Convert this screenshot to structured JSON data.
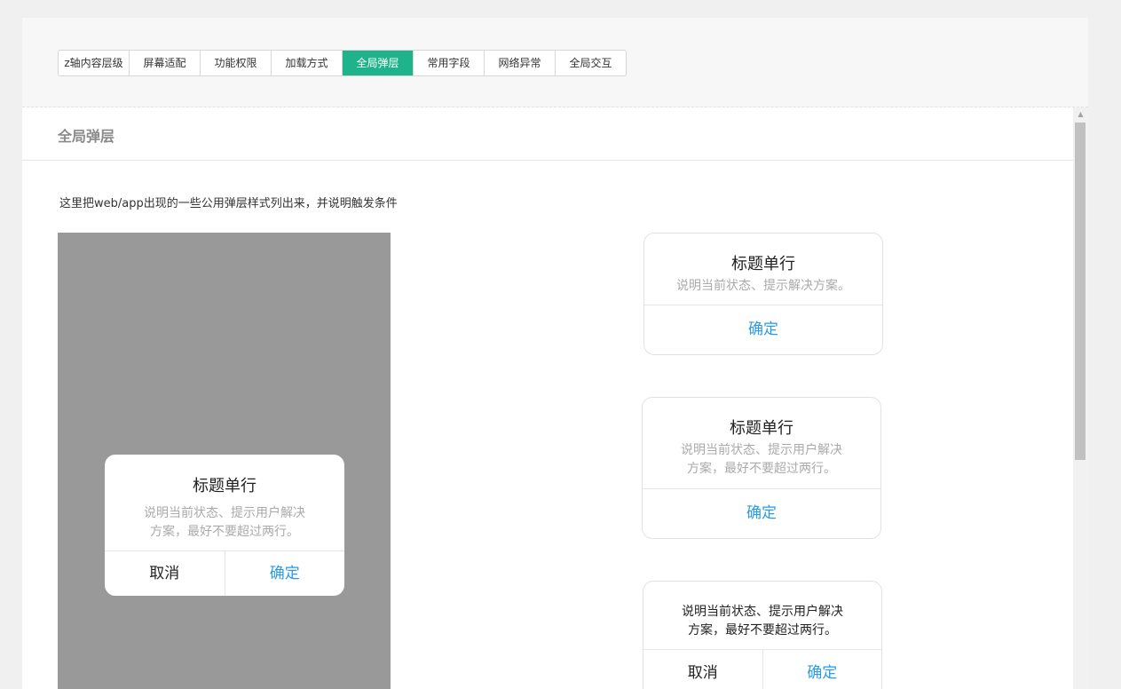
{
  "tabs": [
    {
      "label": "z轴内容层级",
      "active": false
    },
    {
      "label": "屏幕适配",
      "active": false
    },
    {
      "label": "功能权限",
      "active": false
    },
    {
      "label": "加载方式",
      "active": false
    },
    {
      "label": "全局弹层",
      "active": true
    },
    {
      "label": "常用字段",
      "active": false
    },
    {
      "label": "网络异常",
      "active": false
    },
    {
      "label": "全局交互",
      "active": false
    }
  ],
  "section": {
    "title": "全局弹层",
    "description": "这里把web/app出现的一些公用弹层样式列出来，并说明触发条件"
  },
  "phone_dialog": {
    "title": "标题单行",
    "message_line1": "说明当前状态、提示用户解决",
    "message_line2": "方案，最好不要超过两行。",
    "cancel_label": "取消",
    "confirm_label": "确定"
  },
  "samples": {
    "single_line": {
      "title": "标题单行",
      "message": "说明当前状态、提示解决方案。",
      "confirm_label": "确定"
    },
    "two_line": {
      "title": "标题单行",
      "message_line1": "说明当前状态、提示用户解决",
      "message_line2": "方案，最好不要超过两行。",
      "confirm_label": "确定"
    },
    "no_title": {
      "message_line1": "说明当前状态、提示用户解决",
      "message_line2": "方案，最好不要超过两行。",
      "cancel_label": "取消",
      "confirm_label": "确定"
    }
  },
  "colors": {
    "accent_tab": "#1fb38b",
    "confirm_link": "#2a9be6",
    "mask": "#999999"
  }
}
